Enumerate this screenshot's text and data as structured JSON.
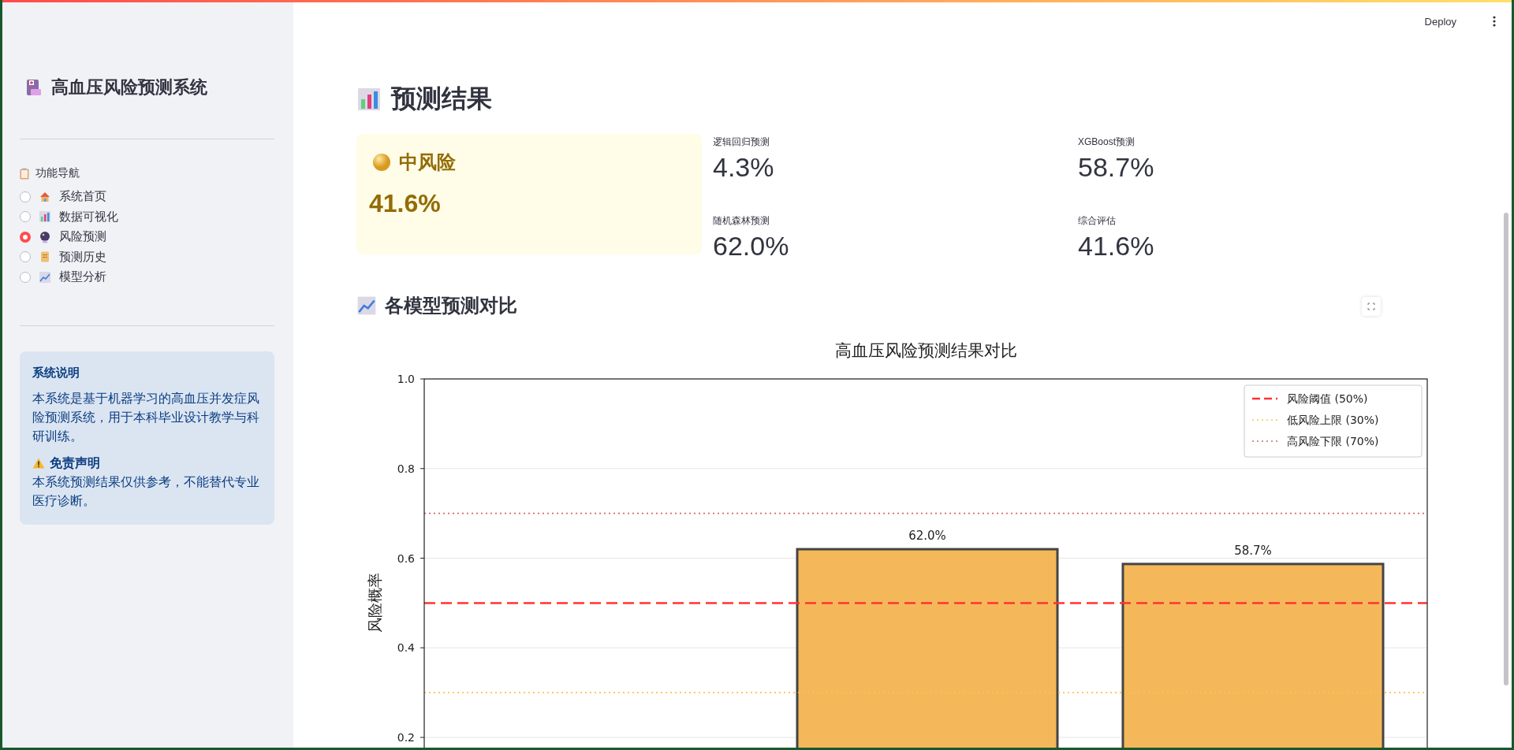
{
  "header": {
    "deploy": "Deploy"
  },
  "sidebar": {
    "title": "高血压风险预测系统",
    "nav_label": "功能导航",
    "nav_items": [
      {
        "label": "系统首页",
        "selected": false
      },
      {
        "label": "数据可视化",
        "selected": false
      },
      {
        "label": "风险预测",
        "selected": true
      },
      {
        "label": "预测历史",
        "selected": false
      },
      {
        "label": "模型分析",
        "selected": false
      }
    ],
    "info": {
      "title": "系统说明",
      "body": "本系统是基于机器学习的高血压并发症风险预测系统，用于本科毕业设计教学与科研训练。",
      "disclaimer_title": "免责声明",
      "disclaimer_body": "本系统预测结果仅供参考，不能替代专业医疗诊断。"
    }
  },
  "main": {
    "heading": "预测结果",
    "risk_card": {
      "level": "中风险",
      "value": "41.6%"
    },
    "metrics": [
      {
        "label": "逻辑回归预测",
        "value": "4.3%"
      },
      {
        "label": "XGBoost预测",
        "value": "58.7%"
      },
      {
        "label": "随机森林预测",
        "value": "62.0%"
      },
      {
        "label": "综合评估",
        "value": "41.6%"
      }
    ],
    "chart_heading": "各模型预测对比",
    "chart": {
      "chart_data": {
        "type": "bar",
        "title": "高血压风险预测结果对比",
        "ylabel": "风险概率",
        "values": [
          null,
          0.62,
          0.587
        ],
        "value_labels": [
          null,
          "62.0%",
          "58.7%"
        ],
        "ylim": [
          0,
          1
        ],
        "yticks": [
          {
            "value": 0.2,
            "label": "0.2"
          },
          {
            "value": 0.4,
            "label": "0.4"
          },
          {
            "value": 0.6,
            "label": "0.6"
          },
          {
            "value": 0.8,
            "label": "0.8"
          },
          {
            "value": 1.0,
            "label": "1.0"
          }
        ],
        "grid": true,
        "legend": "upper right",
        "ref_lines": [
          {
            "axis": "y",
            "value": 0.5,
            "label": "风险阈值 (50%)",
            "color": "#ff3333"
          },
          {
            "axis": "y",
            "value": 0.3,
            "label": "低风险上限 (30%)",
            "color": "#ffc14d"
          },
          {
            "axis": "y",
            "value": 0.7,
            "label": "高风险下限 (70%)",
            "color": "#d46a6a"
          }
        ]
      }
    }
  }
}
